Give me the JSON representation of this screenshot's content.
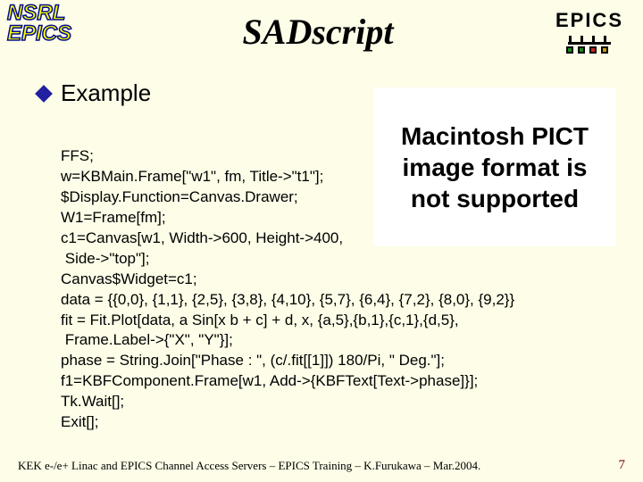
{
  "logo": {
    "nsrl": "NSRL",
    "epics_left": "EPICS"
  },
  "header": {
    "epics_label": "EPICS"
  },
  "title": "SADscript",
  "section": {
    "label": "Example"
  },
  "pict": {
    "message": "Macintosh PICT image format is not supported"
  },
  "code": {
    "lines": [
      "FFS;",
      "w=KBMain.Frame[\"w1\", fm, Title->\"t1\"];",
      "$Display.Function=Canvas.Drawer;",
      "W1=Frame[fm];",
      "c1=Canvas[w1, Width->600, Height->400,",
      " Side->\"top\"];",
      "Canvas$Widget=c1;",
      "data = {{0,0}, {1,1}, {2,5}, {3,8}, {4,10}, {5,7}, {6,4}, {7,2}, {8,0}, {9,2}}",
      "fit = Fit.Plot[data, a Sin[x b + c] + d, x, {a,5},{b,1},{c,1},{d,5},",
      " Frame.Label->{\"X\", \"Y\"}];",
      "phase = String.Join[\"Phase : \", (c/.fit[[1]]) 180/Pi, \" Deg.\"];",
      "f1=KBFComponent.Frame[w1, Add->{KBFText[Text->phase]}];",
      "Tk.Wait[];",
      "Exit[];"
    ]
  },
  "footer": {
    "text": "KEK e-/e+ Linac and EPICS Channel Access Servers – EPICS Training – K.Furukawa – Mar.2004.",
    "page": "7"
  },
  "colors": {
    "background": "#fdfde8",
    "accent_blue": "#2020a0",
    "page_num": "#7a0000",
    "node_colors": [
      "#1e8a1e",
      "#1e8a1e",
      "#c8281e",
      "#c8a000"
    ]
  }
}
